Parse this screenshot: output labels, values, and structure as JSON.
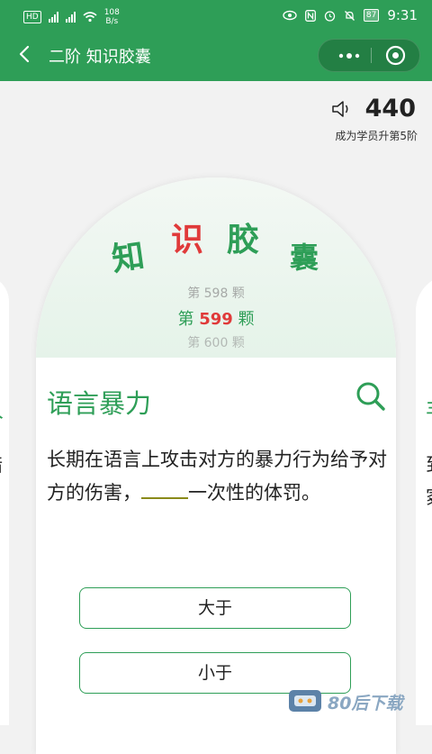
{
  "status": {
    "hd": "HD",
    "sig1": "4G",
    "sig2": "4G",
    "speed_value": "108",
    "speed_unit": "B/s",
    "battery": "87",
    "time": "9:31"
  },
  "nav": {
    "title": "二阶 知识胶囊"
  },
  "score": {
    "value": "440",
    "subtitle": "成为学员升第5阶"
  },
  "card": {
    "logo": [
      "知",
      "识",
      "胶",
      "囊"
    ],
    "prev": "第 598 颗",
    "cur_prefix": "第 ",
    "cur_num": "599",
    "cur_suffix": " 颗",
    "next": "第 600 颗",
    "word": "语言暴力",
    "def_before": "长期在语言上攻击对方的暴力行为给予对方的伤害，",
    "def_after": "一次性的体罚。",
    "options": [
      "大于",
      "小于"
    ]
  },
  "side_left_chars": [
    "人",
    "暗"
  ],
  "side_right_chars": [
    "丰",
    "到",
    "冢"
  ],
  "watermark": "80后下载",
  "colors": {
    "brand_green": "#2e9e57",
    "highlight_red": "#e03a3a"
  }
}
